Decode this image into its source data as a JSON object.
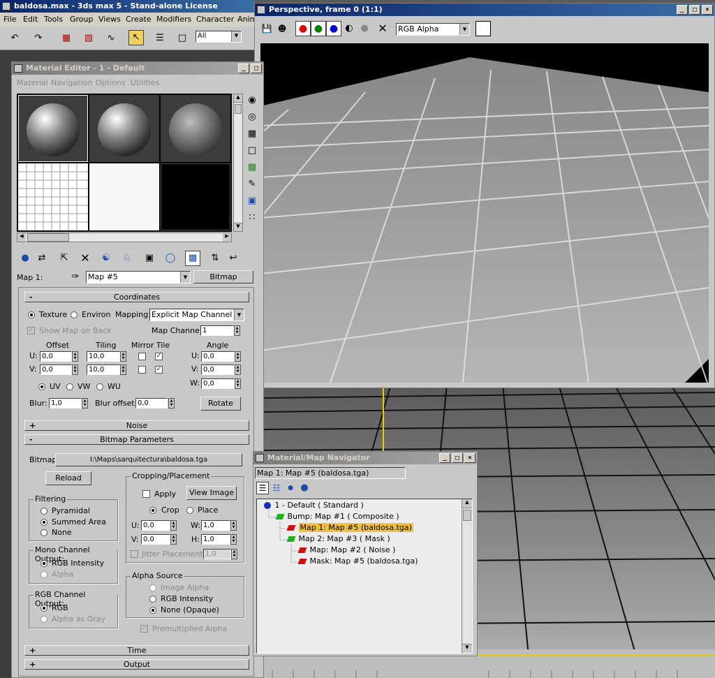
{
  "app": {
    "title": "baldosa.max - 3ds max 5 - Stand-alone License",
    "menu": [
      "File",
      "Edit",
      "Tools",
      "Group",
      "Views",
      "Create",
      "Modifiers",
      "Character",
      "Anim"
    ],
    "selection_filter": "All"
  },
  "material_editor": {
    "title": "Material Editor - 1 - Default",
    "menu": [
      "Material",
      "Navigation",
      "Options",
      "Utilities"
    ],
    "map_label": "Map 1:",
    "map_name": "Map #5",
    "map_type": "Bitmap",
    "coordinates": {
      "header": "Coordinates",
      "texture_label": "Texture",
      "environ_label": "Environ",
      "mapping_label": "Mapping:",
      "mapping_value": "Explicit Map Channel",
      "show_map_label": "Show Map on Back",
      "map_channel_label": "Map Channel:",
      "map_channel_value": "1",
      "offset_label": "Offset",
      "tiling_label": "Tiling",
      "mirror_tile_label": "Mirror Tile",
      "angle_label": "Angle",
      "u_label": "U:",
      "v_label": "V:",
      "w_label": "W:",
      "u_offset": "0,0",
      "v_offset": "0,0",
      "u_tiling": "10,0",
      "v_tiling": "10,0",
      "u_angle": "0,0",
      "v_angle": "0,0",
      "w_angle": "0,0",
      "uv_label": "UV",
      "vw_label": "VW",
      "wu_label": "WU",
      "blur_label": "Blur:",
      "blur_value": "1,0",
      "blur_offset_label": "Blur offset:",
      "blur_offset_value": "0,0",
      "rotate_label": "Rotate"
    },
    "noise_header": "Noise",
    "bitmap_params": {
      "header": "Bitmap Parameters",
      "bitmap_label": "Bitmap:",
      "bitmap_path": "I:\\Maps\\sarquitectura\\baldosa.tga",
      "reload_label": "Reload",
      "filtering_title": "Filtering",
      "filtering": [
        "Pyramidal",
        "Summed Area",
        "None"
      ],
      "mono_title": "Mono Channel Output:",
      "mono": [
        "RGB Intensity",
        "Alpha"
      ],
      "rgb_title": "RGB Channel Output:",
      "rgb": [
        "RGB",
        "Alpha as Gray"
      ],
      "cropping_title": "Cropping/Placement",
      "apply_label": "Apply",
      "view_image_label": "View Image",
      "crop_label": "Crop",
      "place_label": "Place",
      "u_label": "U:",
      "v_label": "V:",
      "w_label": "W:",
      "h_label": "H:",
      "u_value": "0,0",
      "v_value": "0,0",
      "w_value": "1,0",
      "h_value": "1,0",
      "jitter_label": "Jitter Placement:",
      "jitter_value": "1,0",
      "alpha_source_title": "Alpha Source",
      "alpha_source": [
        "Image Alpha",
        "RGB Intensity",
        "None (Opaque)"
      ],
      "premultiplied_label": "Premultiplied Alpha"
    },
    "time_header": "Time",
    "output_header": "Output"
  },
  "render_window": {
    "title": "Perspective, frame 0 (1:1)",
    "channel_value": "RGB Alpha"
  },
  "navigator": {
    "title": "Material/Map Navigator",
    "current": "Map 1: Map #5 (baldosa.tga)",
    "tree": [
      {
        "label": "1 - Default  ( Standard )",
        "depth": 0,
        "color": "#1030c0"
      },
      {
        "label": "Bump: Map #1  ( Composite )",
        "depth": 1,
        "color": "#20b020"
      },
      {
        "label": "Map 1: Map #5 (baldosa.tga)",
        "depth": 2,
        "color": "#d01010"
      },
      {
        "label": "Map 2: Map #3  ( Mask )",
        "depth": 2,
        "color": "#20b020"
      },
      {
        "label": "Map: Map #2  ( Noise )",
        "depth": 3,
        "color": "#d01010"
      },
      {
        "label": "Mask: Map #5 (baldosa.tga)",
        "depth": 3,
        "color": "#d01010"
      }
    ]
  },
  "colors": {
    "titlebar_active": "#0a246a",
    "panel": "#c8c8c8",
    "selected_row": "#f0c040"
  }
}
